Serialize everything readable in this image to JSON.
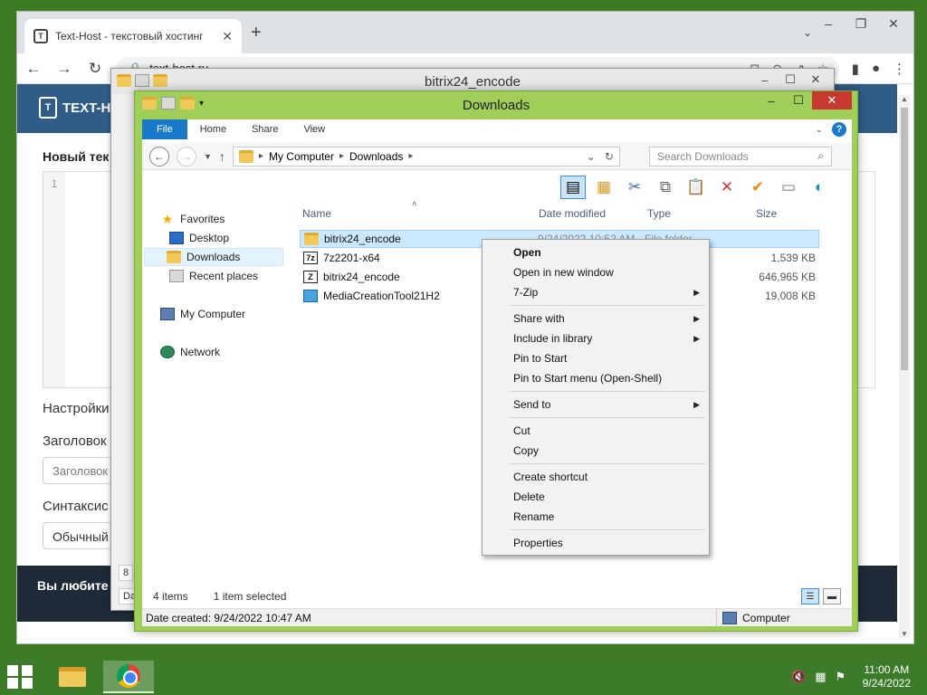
{
  "browser": {
    "tab_title": "Text-Host - текстовый хостинг",
    "tab_icon": "site-favicon",
    "url": "text-host.ru"
  },
  "site": {
    "logo": "TEXT-HOST",
    "card_title": "Новый тек",
    "editor_line": "1",
    "settings_label": "Настройки",
    "title_label": "Заголовок",
    "title_placeholder": "Заголовок",
    "syntax_label": "Синтаксис",
    "syntax_value": "Обычный",
    "footer_text": "Вы любите",
    "stub_number": "8",
    "stub_date": "Date"
  },
  "back_window": {
    "title": "bitrix24_encode"
  },
  "explorer": {
    "title": "Downloads",
    "ribbon_tabs": [
      "File",
      "Home",
      "Share",
      "View"
    ],
    "breadcrumb": [
      "My Computer",
      "Downloads"
    ],
    "search_placeholder": "Search Downloads",
    "nav": {
      "favorites": "Favorites",
      "desktop": "Desktop",
      "downloads": "Downloads",
      "recent": "Recent places",
      "computer": "My Computer",
      "network": "Network"
    },
    "columns": {
      "name": "Name",
      "date": "Date modified",
      "type": "Type",
      "size": "Size"
    },
    "files": [
      {
        "name": "bitrix24_encode",
        "date": "9/24/2022 10:52 AM",
        "type": "File folder",
        "size": ""
      },
      {
        "name": "7z2201-x64",
        "date": "",
        "type": "",
        "size": "1,539 KB"
      },
      {
        "name": "bitrix24_encode",
        "date": "",
        "type": "",
        "size": "646,965 KB"
      },
      {
        "name": "MediaCreationTool21H2",
        "date": "",
        "type": "",
        "size": "19,008 KB"
      }
    ],
    "status_items": "4 items",
    "status_selected": "1 item selected",
    "details_date": "Date created: 9/24/2022 10:47 AM",
    "details_location": "Computer"
  },
  "context_menu": {
    "open": "Open",
    "open_new_window": "Open in new window",
    "sevenzip": "7-Zip",
    "share_with": "Share with",
    "include_in_library": "Include in library",
    "pin_to_start": "Pin to Start",
    "pin_to_start_menu": "Pin to Start menu (Open-Shell)",
    "send_to": "Send to",
    "cut": "Cut",
    "copy": "Copy",
    "create_shortcut": "Create shortcut",
    "delete": "Delete",
    "rename": "Rename",
    "properties": "Properties"
  },
  "taskbar": {
    "time": "11:00 AM",
    "date": "9/24/2022"
  },
  "colors": {
    "desktop": "#3f7a24",
    "explorer_frame": "#9fcf58",
    "ribbon_file": "#1979ca",
    "close_button": "#c7392e",
    "site_header": "#2f5d88"
  }
}
